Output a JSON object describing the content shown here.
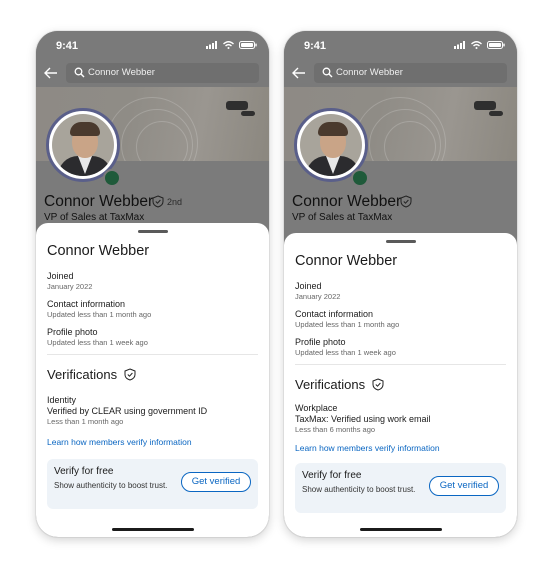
{
  "phones": [
    {
      "status_time": "9:41",
      "search_query": "Connor Webber",
      "profile": {
        "name": "Connor Webber",
        "degree": "2nd",
        "headline": "VP of Sales at TaxMax"
      },
      "sheet": {
        "title": "Connor Webber",
        "joined_label": "Joined",
        "joined_value": "January 2022",
        "contact_label": "Contact information",
        "contact_value": "Updated less than 1 month ago",
        "photo_label": "Profile photo",
        "photo_value": "Updated less than 1 week ago",
        "verifications_title": "Verifications",
        "verification_type": "Identity",
        "verification_detail": "Verified by CLEAR using government ID",
        "verification_time": "Less than 1 month ago",
        "learn_link": "Learn how members verify information",
        "card_title": "Verify for free",
        "card_text": "Show authenticity to boost trust.",
        "card_button": "Get verified"
      }
    },
    {
      "status_time": "9:41",
      "search_query": "Connor Webber",
      "profile": {
        "name": "Connor Webber",
        "degree": "",
        "headline": "VP of Sales at TaxMax"
      },
      "sheet": {
        "title": "Connor Webber",
        "joined_label": "Joined",
        "joined_value": "January 2022",
        "contact_label": "Contact information",
        "contact_value": "Updated less than 1 month ago",
        "photo_label": "Profile photo",
        "photo_value": "Updated less than 1 week ago",
        "verifications_title": "Verifications",
        "verification_type": "Workplace",
        "verification_detail": "TaxMax: Verified using work email",
        "verification_time": "Less than 6 months ago",
        "learn_link": "Learn how members verify information",
        "card_title": "Verify for free",
        "card_text": "Show authenticity to boost trust.",
        "card_button": "Get verified"
      }
    }
  ],
  "colors": {
    "link": "#0a66c2",
    "card_bg": "#eef3f8",
    "overlay": "#7b7b7b",
    "online": "#1f5a3a"
  },
  "icons": [
    "signal-icon",
    "wifi-icon",
    "battery-icon",
    "back-arrow-icon",
    "search-icon",
    "verified-shield-icon"
  ]
}
